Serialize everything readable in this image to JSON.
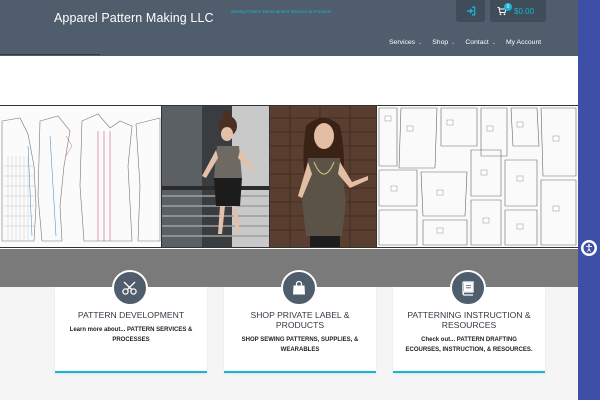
{
  "header": {
    "site_title": "Apparel Pattern Making LLC",
    "tagline": "Sewing Pattern Development Services & Products",
    "cart_count": "0",
    "cart_total": "$0.00",
    "nav": [
      {
        "label": "Services",
        "has_dropdown": true
      },
      {
        "label": "Shop",
        "has_dropdown": true
      },
      {
        "label": "Contact",
        "has_dropdown": true
      },
      {
        "label": "My Account",
        "has_dropdown": false
      }
    ]
  },
  "banner": {
    "panels": [
      "pattern-sketch",
      "model-stairs-photo",
      "model-dress-photo",
      "pattern-pieces-sketch"
    ]
  },
  "cards": [
    {
      "icon": "scissors-icon",
      "title": "PATTERN DEVELOPMENT",
      "desc": "Learn more about... PATTERN SERVICES & PROCESSES"
    },
    {
      "icon": "shopping-bag-icon",
      "title": "SHOP PRIVATE LABEL & PRODUCTS",
      "desc": "SHOP SEWING PATTERNS, SUPPLIES, & WEARABLES"
    },
    {
      "icon": "book-icon",
      "title": "PATTERNING INSTRUCTION & RESOURCES",
      "desc": "Check out... PATTERN DRAFTING ECOURSES, INSTRUCTION, & RESOURCES."
    }
  ],
  "colors": {
    "header_bg": "#4f5d6c",
    "accent": "#19b4d4",
    "side_bar": "#3d4fa6",
    "band_gray": "#7a7a7a"
  }
}
